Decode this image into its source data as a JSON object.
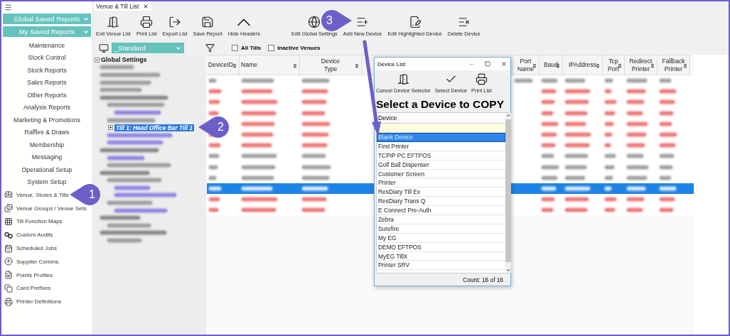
{
  "sidebar": {
    "dropdowns": [
      "Global Saved Reports",
      "My Saved Reports"
    ],
    "menu": [
      "Maintenance",
      "Stock Control",
      "Stock Reports",
      "Sales Reports",
      "Other Reports",
      "Analysis Reports",
      "Marketing & Promotions",
      "Raffles & Draws",
      "Membership",
      "Messaging",
      "Operational Setup",
      "System Setup"
    ],
    "modules": [
      "Venue, Stores & Tills",
      "Venue Groups / Venue Sets",
      "Till Function Maps",
      "Custom Audits",
      "Scheduled Jobs",
      "Supplier Comms.",
      "Points Profiles",
      "Card Prefixes",
      "Printer Definitions"
    ]
  },
  "tab": {
    "label": "Venue & Till List"
  },
  "toolbar": [
    [
      "Exit Venue List",
      "Print List",
      "Export List",
      "Save Report",
      "Hide Headers"
    ],
    [
      "Edit Global Settings",
      "Add New Device",
      "Edit Highlighted Device",
      "Delete Device"
    ]
  ],
  "filter": {
    "layout": "_Standard",
    "checkboxes": [
      {
        "label": "All Tills",
        "checked": false
      },
      {
        "label": "Inactive Venues",
        "checked": false
      }
    ]
  },
  "tree": {
    "root": "Global Settings",
    "items": [
      {
        "kind": "blurred",
        "color": "#a3a3a3",
        "selected": false
      },
      {
        "kind": "blurred",
        "color": "#a3a3a3",
        "selected": false
      },
      {
        "kind": "blurred",
        "color": "#a3a3a3",
        "selected": false
      },
      {
        "kind": "blurred",
        "color": "#a3a3a3",
        "selected": false
      },
      {
        "kind": "blurred",
        "color": "#8f8f8f",
        "selected": false,
        "children": [
          {
            "kind": "blurred",
            "color": "#a3a3a3",
            "selected": false,
            "children": [
              {
                "kind": "blurred",
                "color": "#958ce6",
                "selected": false
              }
            ]
          },
          {
            "kind": "blurred",
            "color": "#a3a3a3",
            "selected": false
          },
          {
            "kind": "text",
            "label": "Till 1: Head Office Bar Till 1",
            "selected": true
          },
          {
            "kind": "blurred",
            "color": "#958ce6",
            "selected": false
          },
          {
            "kind": "blurred",
            "color": "#958ce6",
            "selected": false
          }
        ]
      },
      {
        "kind": "blurred",
        "color": "#8f8f8f",
        "selected": false,
        "children": [
          {
            "kind": "blurred",
            "color": "#958ce6",
            "selected": false
          },
          {
            "kind": "blurred",
            "color": "#a3a3a3",
            "selected": false
          }
        ]
      },
      {
        "kind": "blurred",
        "color": "#8f8f8f",
        "selected": false,
        "children": [
          {
            "kind": "blurred",
            "color": "#a3a3a3",
            "selected": false,
            "children": [
              {
                "kind": "blurred",
                "color": "#958ce6",
                "selected": false
              },
              {
                "kind": "blurred",
                "color": "#958ce6",
                "selected": false
              }
            ]
          },
          {
            "kind": "blurred",
            "color": "#a3a3a3",
            "selected": false,
            "children": [
              {
                "kind": "blurred",
                "color": "#958ce6",
                "selected": false
              }
            ]
          }
        ]
      },
      {
        "kind": "blurred",
        "color": "#8f8f8f",
        "selected": false,
        "children": [
          {
            "kind": "blurred",
            "color": "#a3a3a3",
            "selected": false
          }
        ]
      },
      {
        "kind": "blurred",
        "color": "#8f8f8f",
        "selected": false,
        "children": [
          {
            "kind": "blurred",
            "color": "#a3a3a3",
            "selected": false
          }
        ]
      }
    ]
  },
  "grid": {
    "columns": [
      [
        "DeviceID"
      ],
      [
        "Name"
      ],
      [
        "Device",
        "Type"
      ],
      null,
      [
        "Port",
        "Name"
      ],
      [
        "Baud"
      ],
      [
        "IPAddress"
      ],
      [
        "Tcp",
        "Port"
      ],
      [
        "Redirect",
        "Printer"
      ],
      [
        "Fallback",
        "Printer"
      ]
    ],
    "rows": [
      {
        "color": "#a8a8a8",
        "selected": false
      },
      {
        "color": "#f08080",
        "selected": false
      },
      {
        "color": "#f08080",
        "selected": false
      },
      {
        "color": "#f08080",
        "selected": false
      },
      {
        "color": "#f08080",
        "selected": false
      },
      {
        "color": "#f08080",
        "selected": false
      },
      {
        "color": "#f08080",
        "selected": false
      },
      {
        "color": "#a8a8a8",
        "selected": false
      },
      {
        "color": "#a8a8a8",
        "selected": false
      },
      {
        "color": "#a8a8a8",
        "selected": false
      },
      {
        "color": "#d0e4fa",
        "selected": true
      },
      {
        "color": "#f08080",
        "selected": false
      },
      {
        "color": "#f08080",
        "selected": false
      }
    ]
  },
  "dialog": {
    "title": "Device List",
    "toolbar": [
      "Cancel Device Selector",
      "Select Device",
      "Print List"
    ],
    "heading": "Select a Device to COPY",
    "column": "Device",
    "items": [
      {
        "label": "Blank Device",
        "selected": true
      },
      {
        "label": "First Printer",
        "selected": false
      },
      {
        "label": "TCPIP PC EFTPOS",
        "selected": false
      },
      {
        "label": "Golf Ball Dispenser",
        "selected": false
      },
      {
        "label": "Customer Screen",
        "selected": false
      },
      {
        "label": "Printer",
        "selected": false
      },
      {
        "label": "ResDiary Till Ex",
        "selected": false
      },
      {
        "label": "ResDiary Trans Q",
        "selected": false
      },
      {
        "label": "E Connect Pre-Auth",
        "selected": false
      },
      {
        "label": "Zebra",
        "selected": false
      },
      {
        "label": "Surefire",
        "selected": false
      },
      {
        "label": "My EG",
        "selected": false
      },
      {
        "label": "DEMO EFTPOS",
        "selected": false
      },
      {
        "label": "MyEG TillX",
        "selected": false
      },
      {
        "label": "Printer SRV",
        "selected": false
      }
    ],
    "count": "Count: 16 of 16"
  },
  "callouts": [
    {
      "label": "1"
    },
    {
      "label": "2"
    },
    {
      "label": "3"
    }
  ]
}
